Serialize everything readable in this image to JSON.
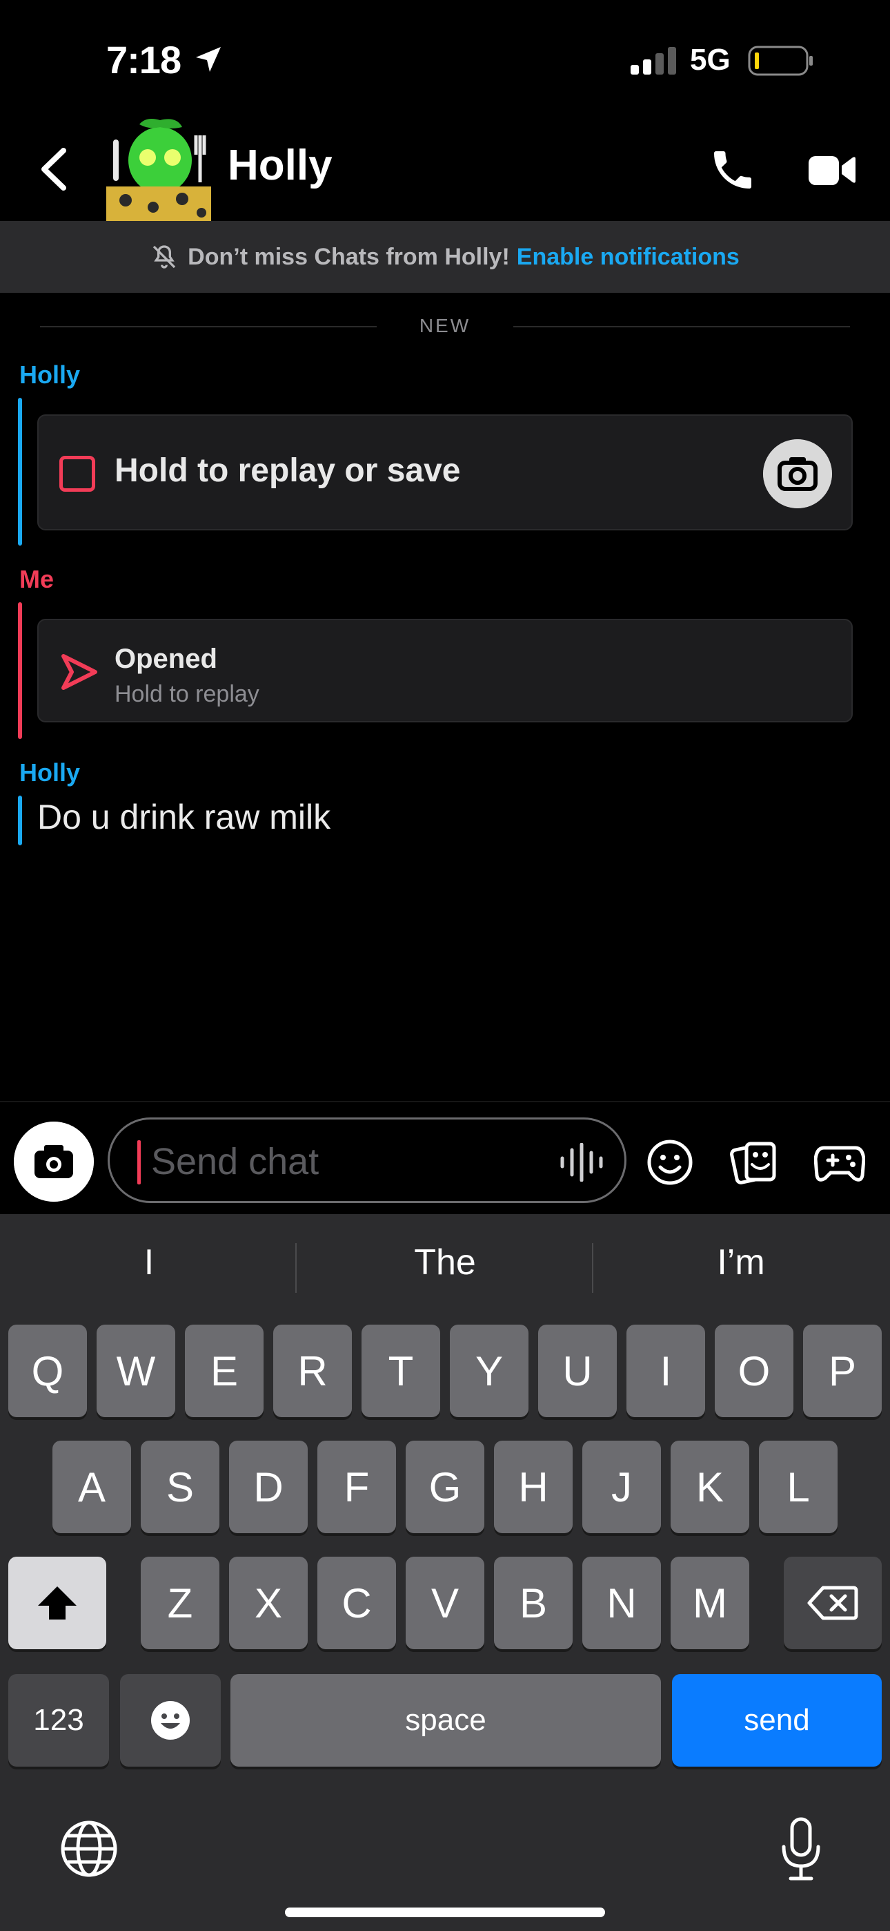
{
  "status_bar": {
    "time": "7:18",
    "network": "5G"
  },
  "header": {
    "contact_name": "Holly"
  },
  "notification_banner": {
    "text": "Don’t miss Chats from Holly!",
    "link": "Enable notifications"
  },
  "chat": {
    "divider_label": "NEW",
    "messages": [
      {
        "sender": "Holly",
        "type": "snap",
        "text": "Hold to replay or save"
      },
      {
        "sender": "Me",
        "type": "sent_snap",
        "status": "Opened",
        "subtext": "Hold to replay"
      },
      {
        "sender": "Holly",
        "type": "text",
        "text": "Do u drink raw milk"
      }
    ]
  },
  "input": {
    "placeholder": "Send chat"
  },
  "keyboard": {
    "suggestions": [
      "I",
      "The",
      "I’m"
    ],
    "row1": [
      "Q",
      "W",
      "E",
      "R",
      "T",
      "Y",
      "U",
      "I",
      "O",
      "P"
    ],
    "row2": [
      "A",
      "S",
      "D",
      "F",
      "G",
      "H",
      "J",
      "K",
      "L"
    ],
    "row3": [
      "Z",
      "X",
      "C",
      "V",
      "B",
      "N",
      "M"
    ],
    "numbers_key": "123",
    "space_key": "space",
    "send_key": "send"
  },
  "colors": {
    "holly": "#1aa9f2",
    "me": "#f23c57",
    "send": "#0a7cff",
    "banner_bg": "#2b2b2d"
  }
}
